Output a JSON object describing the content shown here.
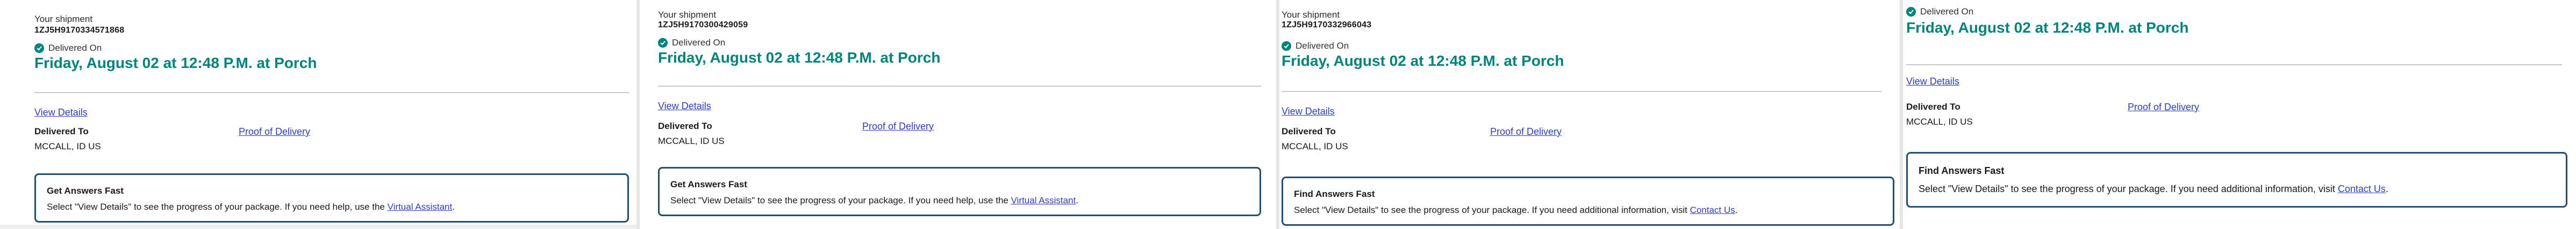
{
  "panels": [
    {
      "your_shipment_label": "Your shipment",
      "tracking_number": "1ZJ5H9170334571868",
      "status": "Delivered On",
      "delivery_date": "Friday, August 02 at 12:48 P.M. at Porch",
      "view_details": "View Details",
      "delivered_to_label": "Delivered To",
      "delivered_to_value": "MCCALL, ID US",
      "proof_of_delivery": "Proof of Delivery",
      "answers_title": "Get Answers Fast",
      "answers_text": "Select \"View Details\" to see the progress of your package. If you need help, use the",
      "answers_link": "Virtual Assistant",
      "answers_suffix": "."
    },
    {
      "your_shipment_label": "Your shipment",
      "tracking_number": "1ZJ5H9170300429059",
      "status": "Delivered On",
      "delivery_date": "Friday, August 02 at 12:48 P.M. at Porch",
      "view_details": "View Details",
      "delivered_to_label": "Delivered To",
      "delivered_to_value": "MCCALL, ID US",
      "proof_of_delivery": "Proof of Delivery",
      "answers_title": "Get Answers Fast",
      "answers_text": "Select \"View Details\" to see the progress of your package. If you need help, use the",
      "answers_link": "Virtual Assistant",
      "answers_suffix": "."
    },
    {
      "your_shipment_label": "Your shipment",
      "tracking_number": "1ZJ5H9170332966043",
      "status": "Delivered On",
      "delivery_date": "Friday, August 02 at 12:48 P.M. at Porch",
      "view_details": "View Details",
      "delivered_to_label": "Delivered To",
      "delivered_to_value": "MCCALL, ID US",
      "proof_of_delivery": "Proof of Delivery",
      "answers_title": "Find Answers Fast",
      "answers_text": "Select \"View Details\" to see the progress of your package. If you need additional information, visit",
      "answers_link": "Contact Us",
      "answers_suffix": "."
    },
    {
      "status": "Delivered On",
      "delivery_date": "Friday, August 02 at 12:48 P.M. at Porch",
      "view_details": "View Details",
      "delivered_to_label": "Delivered To",
      "delivered_to_value": "MCCALL, ID US",
      "proof_of_delivery": "Proof of Delivery",
      "answers_title": "Find Answers Fast",
      "answers_text": "Select \"View Details\" to see the progress of your package. If you need additional information, visit",
      "answers_link": "Contact Us",
      "answers_suffix": "."
    }
  ],
  "colors": {
    "accent_teal": "#00857c",
    "link_blue": "#2e3fc7",
    "box_border": "#1f4e79"
  },
  "icons": {
    "status": "check-circle-icon"
  }
}
